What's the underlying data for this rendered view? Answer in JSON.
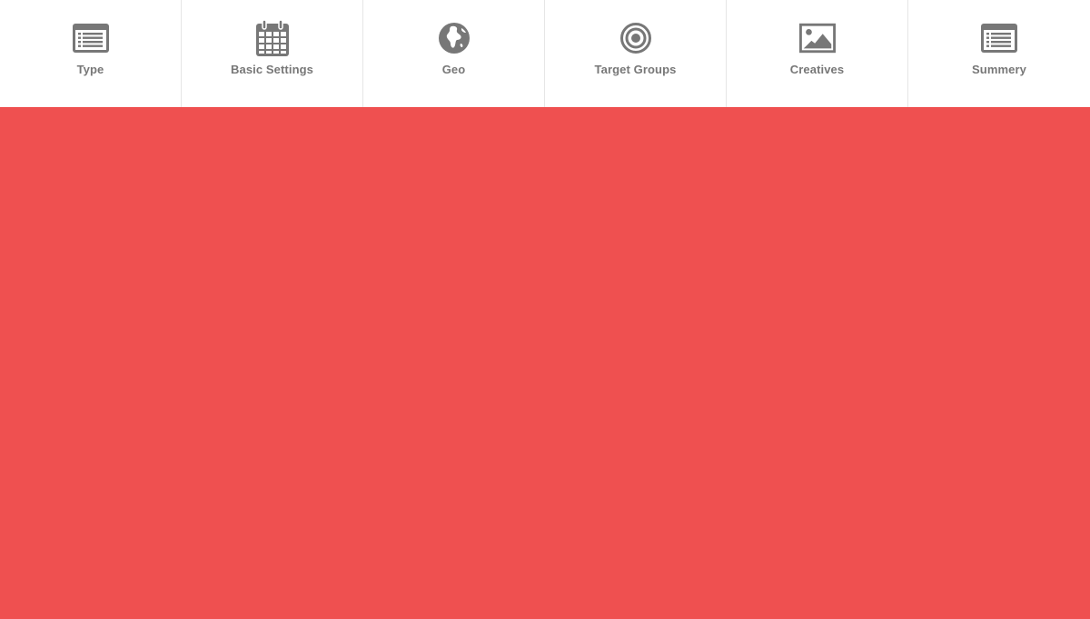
{
  "steps": [
    {
      "label": "Type",
      "icon": "list-card-icon"
    },
    {
      "label": "Basic Settings",
      "icon": "calendar-icon"
    },
    {
      "label": "Geo",
      "icon": "globe-icon"
    },
    {
      "label": "Target Groups",
      "icon": "target-icon"
    },
    {
      "label": "Creatives",
      "icon": "image-icon"
    },
    {
      "label": "Summery",
      "icon": "list-card-icon"
    }
  ],
  "colors": {
    "content_background": "#ef5050",
    "icon": "#777777",
    "label": "#777777",
    "divider": "#e6e6e6"
  }
}
